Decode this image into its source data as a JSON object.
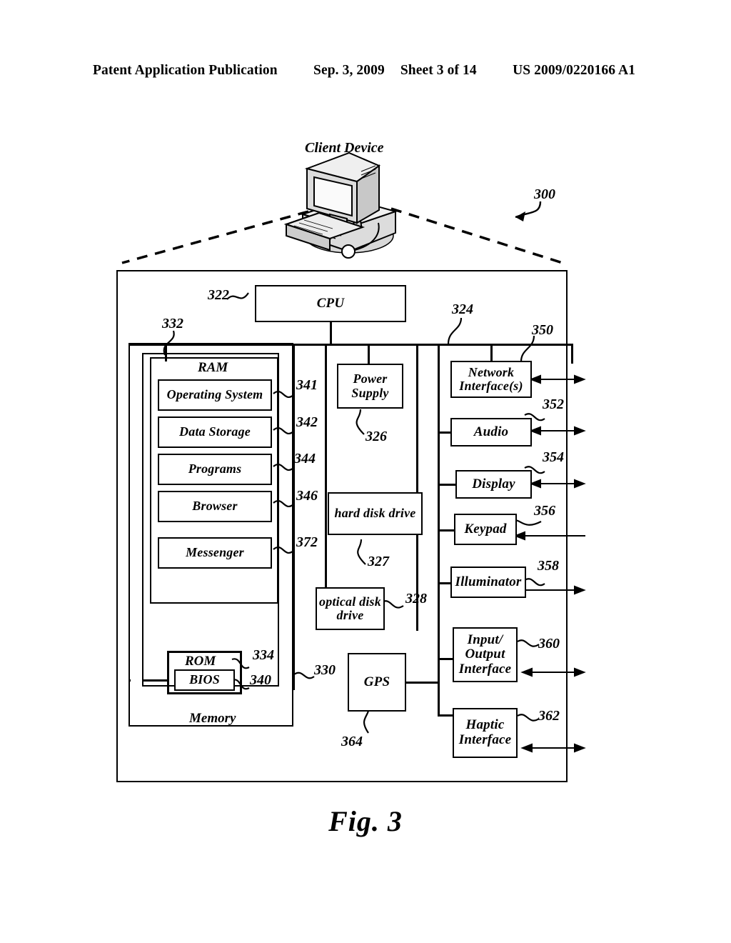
{
  "header": {
    "publication": "Patent Application Publication",
    "date": "Sep. 3, 2009",
    "sheet": "Sheet 3 of 14",
    "patent_number": "US 2009/0220166 A1"
  },
  "figure": {
    "caption": "Fig. 3",
    "device_label": "Client Device",
    "device_ref": "300"
  },
  "blocks": {
    "cpu": {
      "label": "CPU",
      "ref": "322"
    },
    "bus_ref": "324",
    "ram": {
      "label": "RAM",
      "ref": "332"
    },
    "operating_system": {
      "label": "Operating System",
      "ref": "341"
    },
    "data_storage": {
      "label": "Data Storage",
      "ref": "342"
    },
    "programs": {
      "label": "Programs",
      "ref": "344"
    },
    "browser": {
      "label": "Browser",
      "ref": "346"
    },
    "messenger": {
      "label": "Messenger",
      "ref": "372"
    },
    "rom": {
      "label": "ROM",
      "ref": "334"
    },
    "bios": {
      "label": "BIOS",
      "ref": "340"
    },
    "memory": {
      "label": "Memory",
      "ref": "330"
    },
    "power_supply": {
      "label": "Power Supply",
      "ref": "326"
    },
    "hard_disk_drive": {
      "label": "hard disk drive",
      "ref": "327"
    },
    "optical_disk_drive": {
      "label": "optical disk drive",
      "ref": "328"
    },
    "gps": {
      "label": "GPS",
      "ref": "364"
    },
    "network_interfaces": {
      "label": "Network Interface(s)",
      "ref": "350"
    },
    "audio": {
      "label": "Audio",
      "ref": "352"
    },
    "display": {
      "label": "Display",
      "ref": "354"
    },
    "keypad": {
      "label": "Keypad",
      "ref": "356"
    },
    "illuminator": {
      "label": "Illuminator",
      "ref": "358"
    },
    "input_output_interface": {
      "label": "Input/ Output Interface",
      "ref": "360"
    },
    "haptic_interface": {
      "label": "Haptic Interface",
      "ref": "362"
    }
  },
  "colors": {
    "ink": "#000000",
    "paper": "#ffffff"
  }
}
